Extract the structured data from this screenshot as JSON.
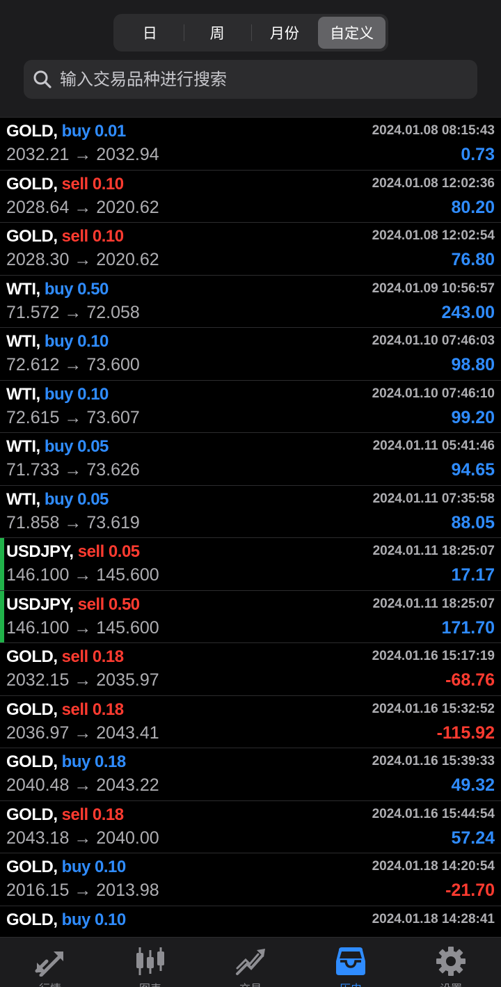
{
  "period_tabs": [
    {
      "label": "日",
      "active": false
    },
    {
      "label": "周",
      "active": false
    },
    {
      "label": "月份",
      "active": false
    },
    {
      "label": "自定义",
      "active": true
    }
  ],
  "search": {
    "placeholder": "输入交易品种进行搜索",
    "value": ""
  },
  "trades": [
    {
      "symbol": "GOLD,",
      "side": "buy",
      "volume": "0.01",
      "open": "2032.21",
      "close": "2032.94",
      "time": "2024.01.08 08:15:43",
      "profit": "0.73",
      "marked": false
    },
    {
      "symbol": "GOLD,",
      "side": "sell",
      "volume": "0.10",
      "open": "2028.64",
      "close": "2020.62",
      "time": "2024.01.08 12:02:36",
      "profit": "80.20",
      "marked": false
    },
    {
      "symbol": "GOLD,",
      "side": "sell",
      "volume": "0.10",
      "open": "2028.30",
      "close": "2020.62",
      "time": "2024.01.08 12:02:54",
      "profit": "76.80",
      "marked": false
    },
    {
      "symbol": "WTI,",
      "side": "buy",
      "volume": "0.50",
      "open": "71.572",
      "close": "72.058",
      "time": "2024.01.09 10:56:57",
      "profit": "243.00",
      "marked": false
    },
    {
      "symbol": "WTI,",
      "side": "buy",
      "volume": "0.10",
      "open": "72.612",
      "close": "73.600",
      "time": "2024.01.10 07:46:03",
      "profit": "98.80",
      "marked": false
    },
    {
      "symbol": "WTI,",
      "side": "buy",
      "volume": "0.10",
      "open": "72.615",
      "close": "73.607",
      "time": "2024.01.10 07:46:10",
      "profit": "99.20",
      "marked": false
    },
    {
      "symbol": "WTI,",
      "side": "buy",
      "volume": "0.05",
      "open": "71.733",
      "close": "73.626",
      "time": "2024.01.11 05:41:46",
      "profit": "94.65",
      "marked": false
    },
    {
      "symbol": "WTI,",
      "side": "buy",
      "volume": "0.05",
      "open": "71.858",
      "close": "73.619",
      "time": "2024.01.11 07:35:58",
      "profit": "88.05",
      "marked": false
    },
    {
      "symbol": "USDJPY,",
      "side": "sell",
      "volume": "0.05",
      "open": "146.100",
      "close": "145.600",
      "time": "2024.01.11 18:25:07",
      "profit": "17.17",
      "marked": true
    },
    {
      "symbol": "USDJPY,",
      "side": "sell",
      "volume": "0.50",
      "open": "146.100",
      "close": "145.600",
      "time": "2024.01.11 18:25:07",
      "profit": "171.70",
      "marked": true
    },
    {
      "symbol": "GOLD,",
      "side": "sell",
      "volume": "0.18",
      "open": "2032.15",
      "close": "2035.97",
      "time": "2024.01.16 15:17:19",
      "profit": "-68.76",
      "marked": false
    },
    {
      "symbol": "GOLD,",
      "side": "sell",
      "volume": "0.18",
      "open": "2036.97",
      "close": "2043.41",
      "time": "2024.01.16 15:32:52",
      "profit": "-115.92",
      "marked": false
    },
    {
      "symbol": "GOLD,",
      "side": "buy",
      "volume": "0.18",
      "open": "2040.48",
      "close": "2043.22",
      "time": "2024.01.16 15:39:33",
      "profit": "49.32",
      "marked": false
    },
    {
      "symbol": "GOLD,",
      "side": "sell",
      "volume": "0.18",
      "open": "2043.18",
      "close": "2040.00",
      "time": "2024.01.16 15:44:54",
      "profit": "57.24",
      "marked": false
    },
    {
      "symbol": "GOLD,",
      "side": "buy",
      "volume": "0.10",
      "open": "2016.15",
      "close": "2013.98",
      "time": "2024.01.18 14:20:54",
      "profit": "-21.70",
      "marked": false
    },
    {
      "symbol": "GOLD,",
      "side": "buy",
      "volume": "0.10",
      "open": "",
      "close": "",
      "time": "2024.01.18 14:28:41",
      "profit": "",
      "marked": false
    }
  ],
  "arrow": "→",
  "bottom_tabs": [
    {
      "label": "行情",
      "icon": "quotes-icon",
      "active": false
    },
    {
      "label": "图表",
      "icon": "candlestick-chart-icon",
      "active": false
    },
    {
      "label": "交易",
      "icon": "trade-trend-icon",
      "active": false
    },
    {
      "label": "历史",
      "icon": "history-inbox-icon",
      "active": true
    },
    {
      "label": "设置",
      "icon": "gear-icon",
      "active": false
    }
  ],
  "colors": {
    "buy": "#2f8cff",
    "sell": "#ff3b30",
    "positive": "#2f8cff",
    "negative": "#ff3b30",
    "marker": "#21b24a"
  }
}
